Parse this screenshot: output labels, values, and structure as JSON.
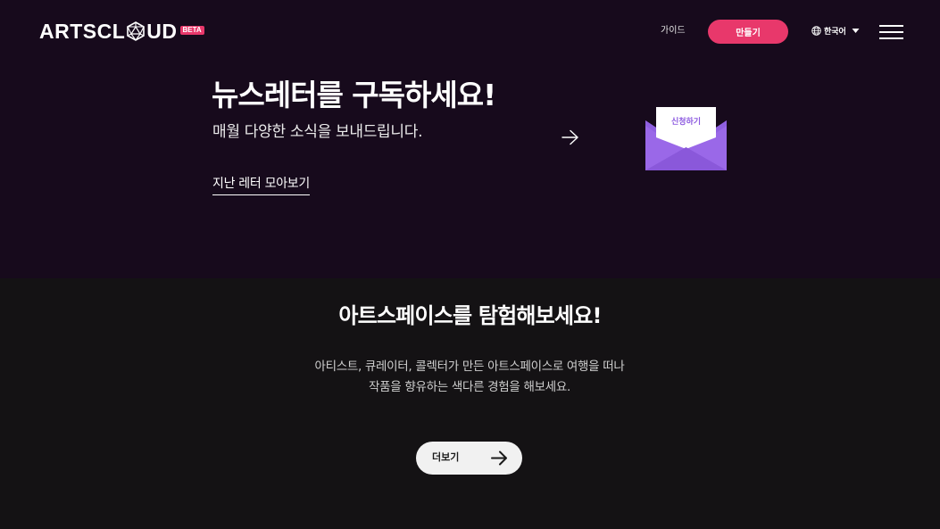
{
  "header": {
    "logo_left": "ARTSCL",
    "logo_right": "UD",
    "logo_badge": "BETA",
    "nav_guide": "가이드",
    "create_button": "만들기",
    "language": "한국어"
  },
  "newsletter": {
    "title": "뉴스레터를 구독하세요!",
    "subtitle": "매월 다양한 소식을 보내드립니다.",
    "archive_link": "지난 레터 모아보기",
    "subscribe_label": "신청하기"
  },
  "explore": {
    "title": "아트스페이스를 탐험해보세요!",
    "description_line1": "아티스트, 큐레이터, 콜렉터가 만든 아트스페이스로 여행을 떠나",
    "description_line2": "작품을 향유하는 색다른 경험을 해보세요.",
    "more_button": "더보기"
  },
  "colors": {
    "accent": "#e8386b",
    "newsletter_bg": "#170a1c",
    "page_bg": "#141214",
    "envelope": "#9a68e8"
  },
  "icons": {
    "globe": "globe-icon",
    "caret": "caret-down-icon",
    "menu": "hamburger-menu-icon",
    "arrow": "arrow-right-icon",
    "envelope": "envelope-icon"
  }
}
